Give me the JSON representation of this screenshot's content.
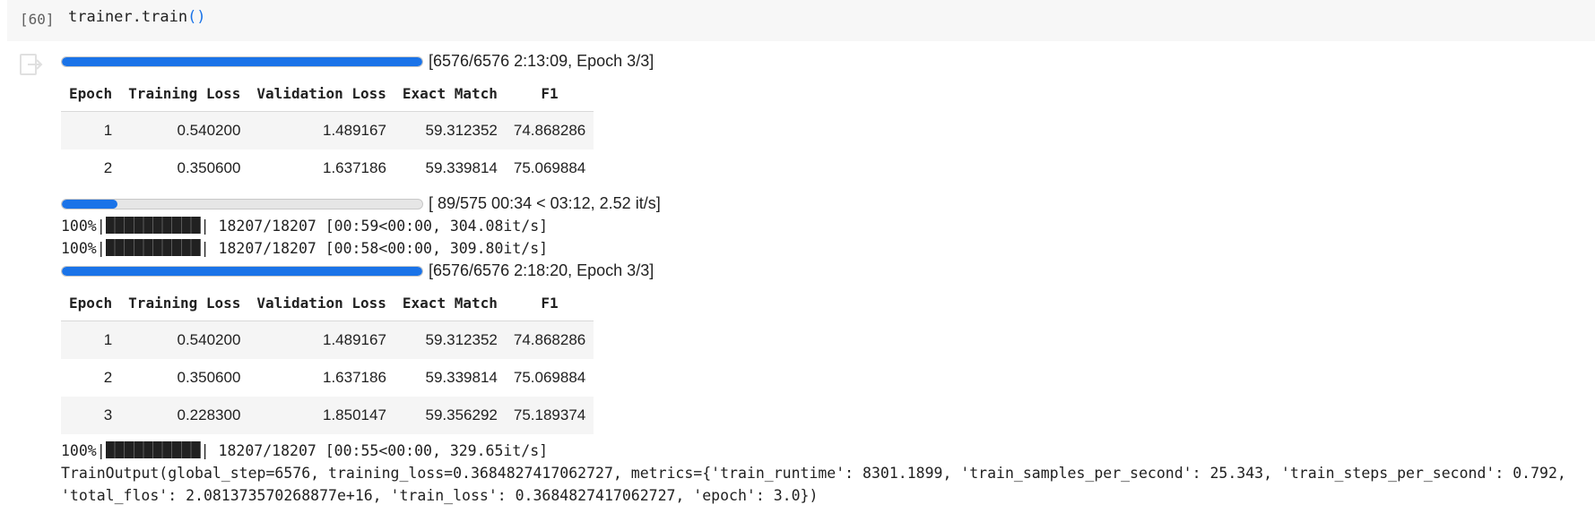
{
  "cell": {
    "execution_count": "[60]",
    "code_prefix": "trainer.train",
    "code_parens": "()"
  },
  "output": {
    "progress1": {
      "fraction": 1.0,
      "label": "[6576/6576 2:13:09, Epoch 3/3]"
    },
    "table1": {
      "headers": [
        "Epoch",
        "Training Loss",
        "Validation Loss",
        "Exact Match",
        "F1"
      ],
      "rows": [
        [
          "1",
          "0.540200",
          "1.489167",
          "59.312352",
          "74.868286"
        ],
        [
          "2",
          "0.350600",
          "1.637186",
          "59.339814",
          "75.069884"
        ]
      ]
    },
    "progress2": {
      "fraction": 0.155,
      "label": "[ 89/575 00:34 < 03:12, 2.52 it/s]"
    },
    "tqdm1": {
      "prefix": "100%|",
      "suffix": "| 18207/18207 [00:59<00:00, 304.08it/s]"
    },
    "tqdm2": {
      "prefix": "100%|",
      "suffix": "| 18207/18207 [00:58<00:00, 309.80it/s]"
    },
    "progress3": {
      "fraction": 1.0,
      "label": "[6576/6576 2:18:20, Epoch 3/3]"
    },
    "table2": {
      "headers": [
        "Epoch",
        "Training Loss",
        "Validation Loss",
        "Exact Match",
        "F1"
      ],
      "rows": [
        [
          "1",
          "0.540200",
          "1.489167",
          "59.312352",
          "74.868286"
        ],
        [
          "2",
          "0.350600",
          "1.637186",
          "59.339814",
          "75.069884"
        ],
        [
          "3",
          "0.228300",
          "1.850147",
          "59.356292",
          "75.189374"
        ]
      ]
    },
    "tqdm3": {
      "prefix": "100%|",
      "suffix": "| 18207/18207 [00:55<00:00, 329.65it/s]"
    },
    "train_output": "TrainOutput(global_step=6576, training_loss=0.3684827417062727, metrics={'train_runtime': 8301.1899, 'train_samples_per_second': 25.343, 'train_steps_per_second': 0.792, 'total_flos': 2.081373570268877e+16, 'train_loss': 0.3684827417062727, 'epoch': 3.0})"
  },
  "colors": {
    "progress_fill": "#1a73e8",
    "code_paren": "#1a73e8",
    "cell_bg": "#f7f7f7"
  },
  "icons": {
    "output_toggle": "output-toggle-icon"
  }
}
